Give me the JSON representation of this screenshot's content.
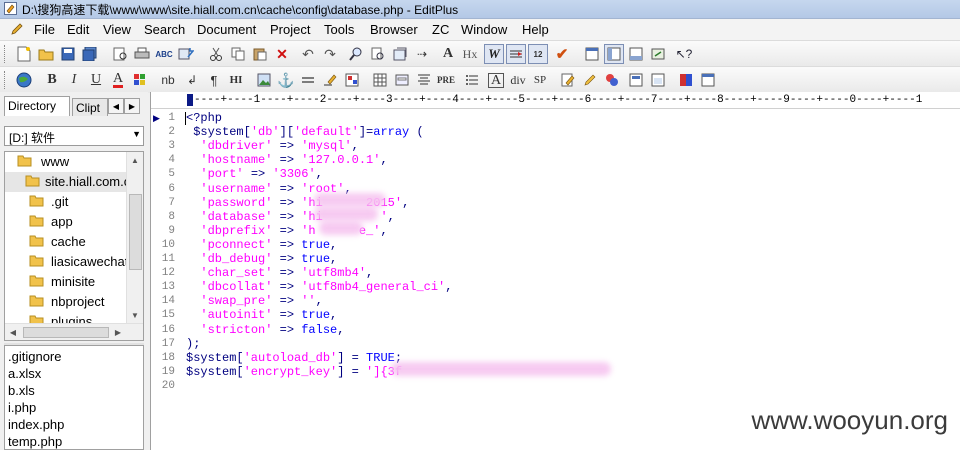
{
  "window": {
    "title": "D:\\搜狗高速下载\\www\\www\\site.hiall.com.cn\\cache\\config\\database.php - EditPlus"
  },
  "menu": {
    "items": [
      "File",
      "Edit",
      "View",
      "Search",
      "Document",
      "Project",
      "Tools",
      "Browser",
      "ZC",
      "Window",
      "Help"
    ]
  },
  "toolbar2": {
    "labels": {
      "bold": "B",
      "italic": "I",
      "underline": "U",
      "font_color": "A",
      "nb": "nb",
      "para": "¶",
      "hi": "HI",
      "pre": "PRE",
      "div": "div",
      "sp": "SP",
      "hx": "Hx",
      "w": "W"
    }
  },
  "sidebar": {
    "tabs": [
      "Directory",
      "Clipt"
    ],
    "drive": "[D:] 软件",
    "tree": [
      "www",
      "site.hiall.com.c",
      ".git",
      "app",
      "cache",
      "liasicawechat",
      "minisite",
      "nbproject",
      "plugins"
    ],
    "files": [
      ".gitignore",
      "a.xlsx",
      "b.xls",
      "i.php",
      "index.php",
      "temp.php"
    ]
  },
  "editor": {
    "ruler": "----+----1----+----2----+----3----+----4----+----5----+----6----+----7----+----8----+----9----+----0----+----1",
    "line_numbers": [
      "1",
      "2",
      "3",
      "4",
      "5",
      "6",
      "7",
      "8",
      "9",
      "10",
      "11",
      "12",
      "13",
      "14",
      "15",
      "16",
      "17",
      "18",
      "19",
      "20"
    ],
    "lines": [
      "<?php",
      " $system['db']['default']=array (",
      "  'dbdriver' => 'mysql',",
      "  'hostname' => '127.0.0.1',",
      "  'port' => '3306',",
      "  'username' => 'root',",
      "  'password' => 'hi      2015',",
      "  'database' => 'hi        ',",
      "  'dbprefix' => 'h      e_',",
      "  'pconnect' => true,",
      "  'db_debug' => true,",
      "  'char_set' => 'utf8mb4',",
      "  'dbcollat' => 'utf8mb4_general_ci',",
      "  'swap_pre' => '',",
      "  'autoinit' => true,",
      "  'stricton' => false,",
      ");",
      "$system['autoload_db'] = TRUE;",
      "$system['encrypt_key'] = ']{3f",
      ""
    ]
  },
  "watermark": "www.wooyun.org",
  "colors": {
    "string": "#ff00ff",
    "variable": "#000080",
    "keyword": "#0000ff",
    "line_number": "#808080"
  }
}
